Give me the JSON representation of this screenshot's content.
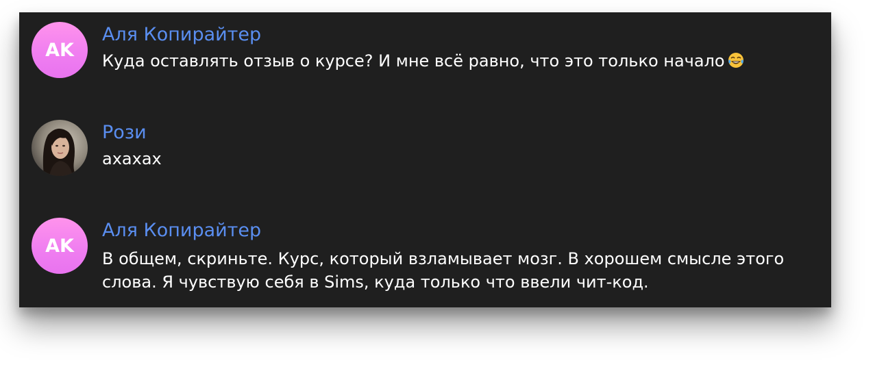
{
  "messages": [
    {
      "author": "Аля Копирайтер",
      "avatar_initials": "AK",
      "avatar_type": "initials",
      "text": "Куда оставлять отзыв о курсе? И мне всё равно, что это только начало",
      "emoji": "tears-of-joy-emoji"
    },
    {
      "author": "Рози",
      "avatar_type": "photo",
      "text": "ахахах"
    },
    {
      "author": "Аля Копирайтер",
      "avatar_initials": "AK",
      "avatar_type": "initials",
      "text": "В общем, скриньте. Курс, который взламывает мозг. В хорошем смысле этого слова. Я чувствую себя в Sims, куда только что ввели чит-код."
    }
  ],
  "colors": {
    "panel_bg": "#1f1f1f",
    "author": "#5a8ef0",
    "text": "#ffffff",
    "avatar_gradient_top": "#ff93ec",
    "avatar_gradient_bottom": "#e873ef"
  }
}
